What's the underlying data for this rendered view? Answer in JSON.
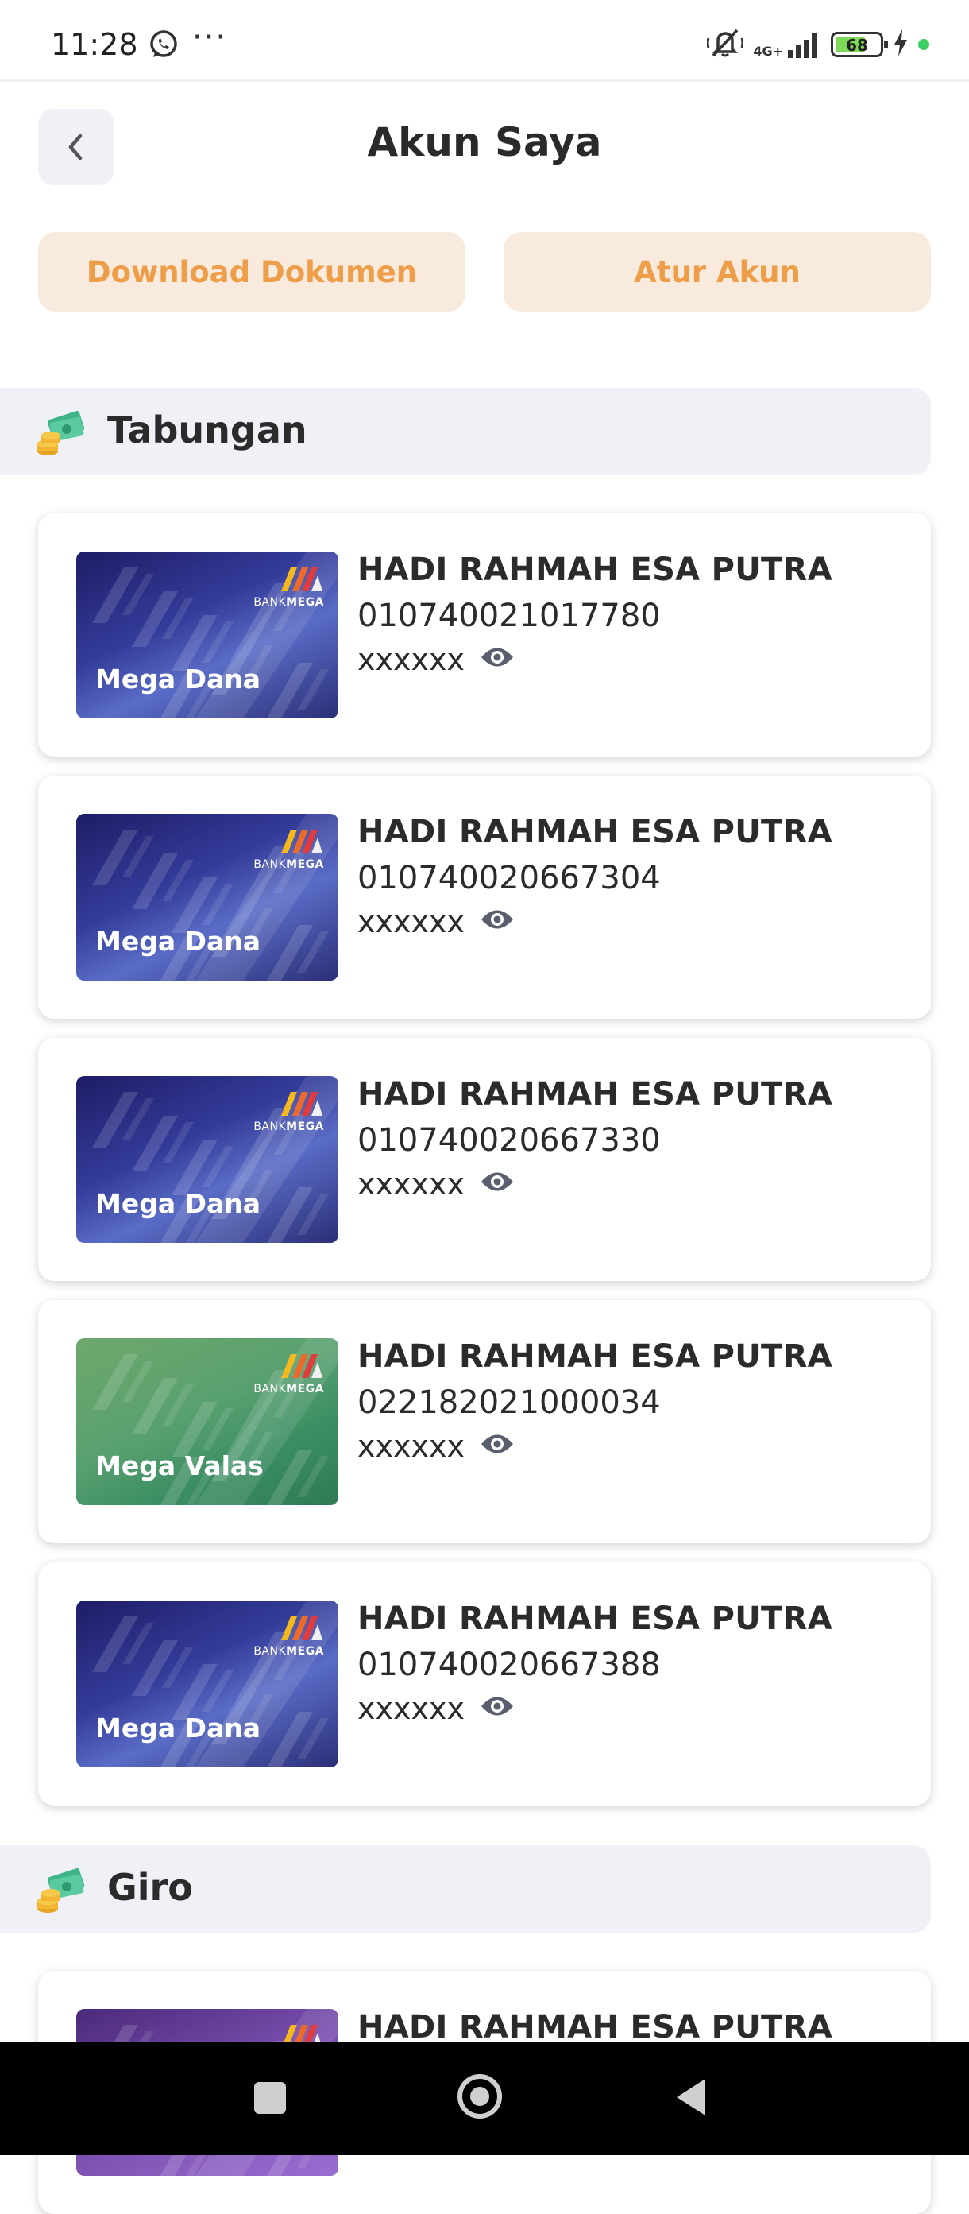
{
  "status_bar": {
    "time": "11:28",
    "dots": "···",
    "network": "4G+",
    "battery": "68",
    "battery_level": 0.68,
    "icons": [
      "whatsapp-icon",
      "more-icon",
      "mute-icon",
      "signal-icon",
      "battery-icon",
      "charging-icon"
    ]
  },
  "header": {
    "title": "Akun Saya",
    "back_icon": "chevron-left-icon"
  },
  "actions": {
    "download_label": "Download Dokumen",
    "atur_label": "Atur Akun"
  },
  "colors": {
    "accent_text": "#ee9e48",
    "accent_bg": "#f8eadc",
    "section_bg": "#f0f1f6"
  },
  "sections": [
    {
      "title": "Tabungan",
      "icon": "money-icon",
      "accounts": [
        {
          "card_label": "Mega Dana",
          "theme": "blue",
          "name": "HADI RAHMAH ESA PUTRA",
          "number": "010740021017780",
          "balance": "xxxxxx"
        },
        {
          "card_label": "Mega Dana",
          "theme": "blue",
          "name": "HADI RAHMAH ESA PUTRA",
          "number": "010740020667304",
          "balance": "xxxxxx"
        },
        {
          "card_label": "Mega Dana",
          "theme": "blue",
          "name": "HADI RAHMAH ESA PUTRA",
          "number": "010740020667330",
          "balance": "xxxxxx"
        },
        {
          "card_label": "Mega Valas",
          "theme": "green",
          "name": "HADI RAHMAH ESA PUTRA",
          "number": "022182021000034",
          "balance": "xxxxxx"
        },
        {
          "card_label": "Mega Dana",
          "theme": "blue",
          "name": "HADI RAHMAH ESA PUTRA",
          "number": "010740020667388",
          "balance": "xxxxxx"
        }
      ]
    },
    {
      "title": "Giro",
      "icon": "money-icon",
      "accounts": [
        {
          "theme": "purple",
          "name": "HADI RAHMAH ESA PUTRA"
        }
      ]
    }
  ],
  "card_logo": {
    "prefix": "BANK",
    "suffix": "MEGA"
  },
  "nav": {
    "icons": [
      "recents-icon",
      "home-icon",
      "back-icon"
    ]
  }
}
